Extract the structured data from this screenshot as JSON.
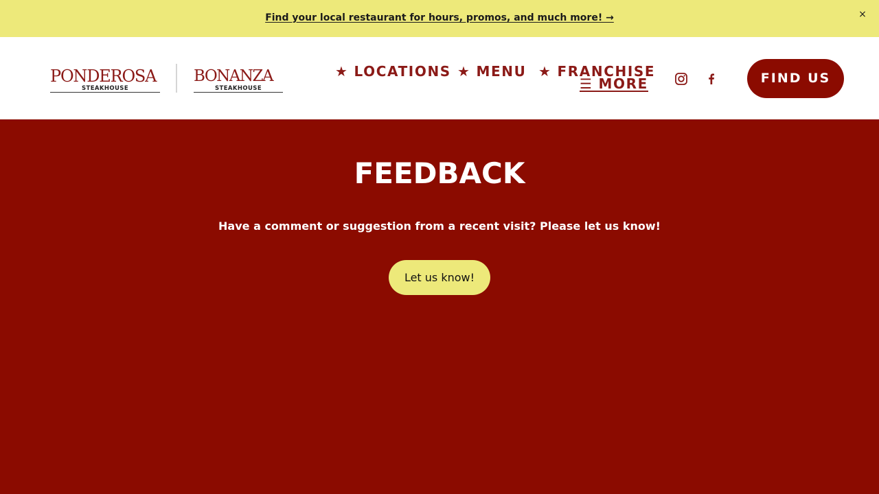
{
  "announcement": {
    "text": "Find your local restaurant for hours, promos, and much more! →",
    "close_icon": "×"
  },
  "header": {
    "logos": {
      "ponderosa": {
        "name": "PONDEROSA",
        "sub": "STEAKHOUSE"
      },
      "bonanza": {
        "name": "BONANZA",
        "sub": "STEAKHOUSE"
      }
    },
    "nav": {
      "star_icon": "★",
      "locations": "LOCATIONS",
      "menu": "MENU",
      "franchise": "FRANCHISE",
      "more_icon": "☰",
      "more": "MORE"
    },
    "social": {
      "instagram_icon": "instagram-icon",
      "facebook_icon": "facebook-icon"
    },
    "find_us": "FIND US"
  },
  "main": {
    "title": "FEEDBACK",
    "subtitle": "Have a comment or suggestion from a recent visit? Please let us know!",
    "cta": "Let us know!"
  },
  "colors": {
    "brand_red": "#8b0b00",
    "logo_red": "#8b1a17",
    "accent_yellow": "#ede97a",
    "white": "#ffffff"
  }
}
